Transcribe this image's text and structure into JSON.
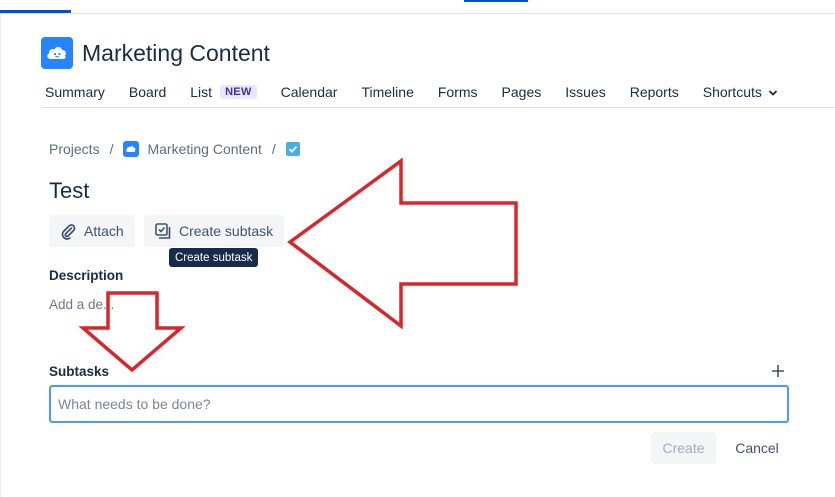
{
  "project": {
    "name": "Marketing Content",
    "icon": "cloud-icon",
    "icon_color": "#2684FF"
  },
  "nav": {
    "items": [
      {
        "label": "Summary"
      },
      {
        "label": "Board"
      },
      {
        "label": "List",
        "badge": "NEW"
      },
      {
        "label": "Calendar"
      },
      {
        "label": "Timeline"
      },
      {
        "label": "Forms"
      },
      {
        "label": "Pages"
      },
      {
        "label": "Issues"
      },
      {
        "label": "Reports"
      },
      {
        "label": "Shortcuts",
        "icon": "chevron-down-icon"
      }
    ]
  },
  "breadcrumb": {
    "projects": "Projects",
    "separator": "/",
    "project": "Marketing Content",
    "issue_type_icon": "checkbox-icon"
  },
  "issue": {
    "title": "Test"
  },
  "actions": {
    "attach_label": "Attach",
    "attach_icon": "paperclip-icon",
    "create_subtask_label": "Create subtask",
    "create_subtask_icon": "subtask-icon",
    "tooltip": "Create subtask"
  },
  "description": {
    "label": "Description",
    "placeholder": "Add a de..."
  },
  "subtasks": {
    "label": "Subtasks",
    "add_icon": "plus-icon",
    "input_placeholder": "What needs to be done?",
    "create_label": "Create",
    "cancel_label": "Cancel"
  },
  "annotations": {
    "arrow_color": "#D9262B",
    "arrows": [
      "left-arrow-annotation",
      "down-arrow-annotation"
    ]
  },
  "colors": {
    "accent": "#0052CC",
    "focus_border": "#4C9AFF",
    "text": "#172B4D"
  }
}
